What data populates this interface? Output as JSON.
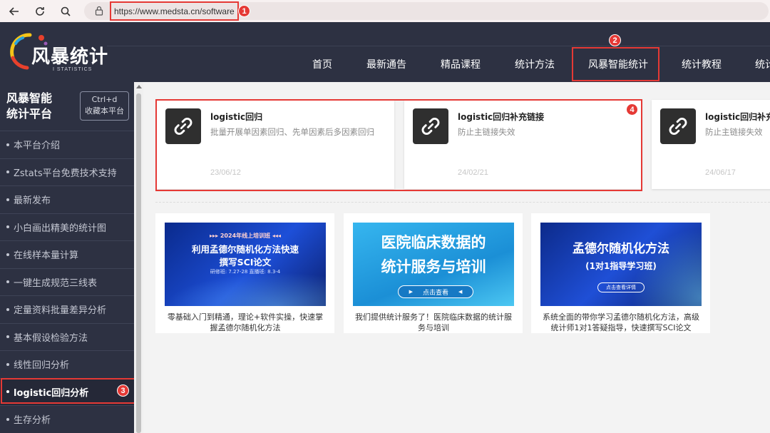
{
  "browser": {
    "url": "https://www.medsta.cn/software",
    "callouts": [
      "1",
      "2",
      "3",
      "4"
    ]
  },
  "header": {
    "logo_text": "风暴统计",
    "logo_sub": "I STATISTICS",
    "nav": [
      "首页",
      "最新通告",
      "精品课程",
      "统计方法",
      "风暴智能统计",
      "统计教程",
      "统计"
    ]
  },
  "sidebar": {
    "title_line1": "风暴智能",
    "title_line2": "统计平台",
    "bookmark_line1": "Ctrl+d",
    "bookmark_line2": "收藏本平台",
    "items": [
      "本平台介绍",
      "Zstats平台免费技术支持",
      "最新发布",
      "小白画出精美的统计图",
      "在线样本量计算",
      "一键生成规范三线表",
      "定量资料批量差异分析",
      "基本假设检验方法",
      "线性回归分析",
      "logistic回归分析",
      "生存分析"
    ],
    "active_index": 9
  },
  "cards": [
    {
      "title": "logistic回归",
      "desc": "批量开展单因素回归、先单因素后多因素回归",
      "date": "23/06/12"
    },
    {
      "title": "logistic回归补充链接",
      "desc": "防止主链接失效",
      "date": "24/02/21"
    },
    {
      "title": "logistic回归补充链接",
      "desc": "防止主链接失效",
      "date": "24/06/17"
    }
  ],
  "promos": [
    {
      "banner_top": "▸▸▸ 2024年线上培训班 ◂◂◂",
      "banner_title1": "利用孟德尔随机化方法快速",
      "banner_title2": "撰写SCI论文",
      "banner_meta": "研修班: 7.27-28  直播班: 8.3-4",
      "caption": "零基础入门到精通，理论+软件实操，快速掌握孟德尔随机化方法"
    },
    {
      "banner_title1": "医院临床数据的",
      "banner_title2": "统计服务与培训",
      "banner_btn": "点击查看",
      "caption": "我们提供统计服务了！医院临床数据的统计服务与培训"
    },
    {
      "banner_title1": "孟德尔随机化方法",
      "banner_title2": "(1对1指导学习班)",
      "banner_btn": "点击查看详情",
      "caption": "系统全面的带你学习孟德尔随机化方法，高级统计师1对1答疑指导，快速撰写SCI论文"
    }
  ],
  "colors": {
    "header_bg": "#2d3142",
    "highlight_red": "#e53935",
    "main_bg": "#f3f3f3"
  }
}
